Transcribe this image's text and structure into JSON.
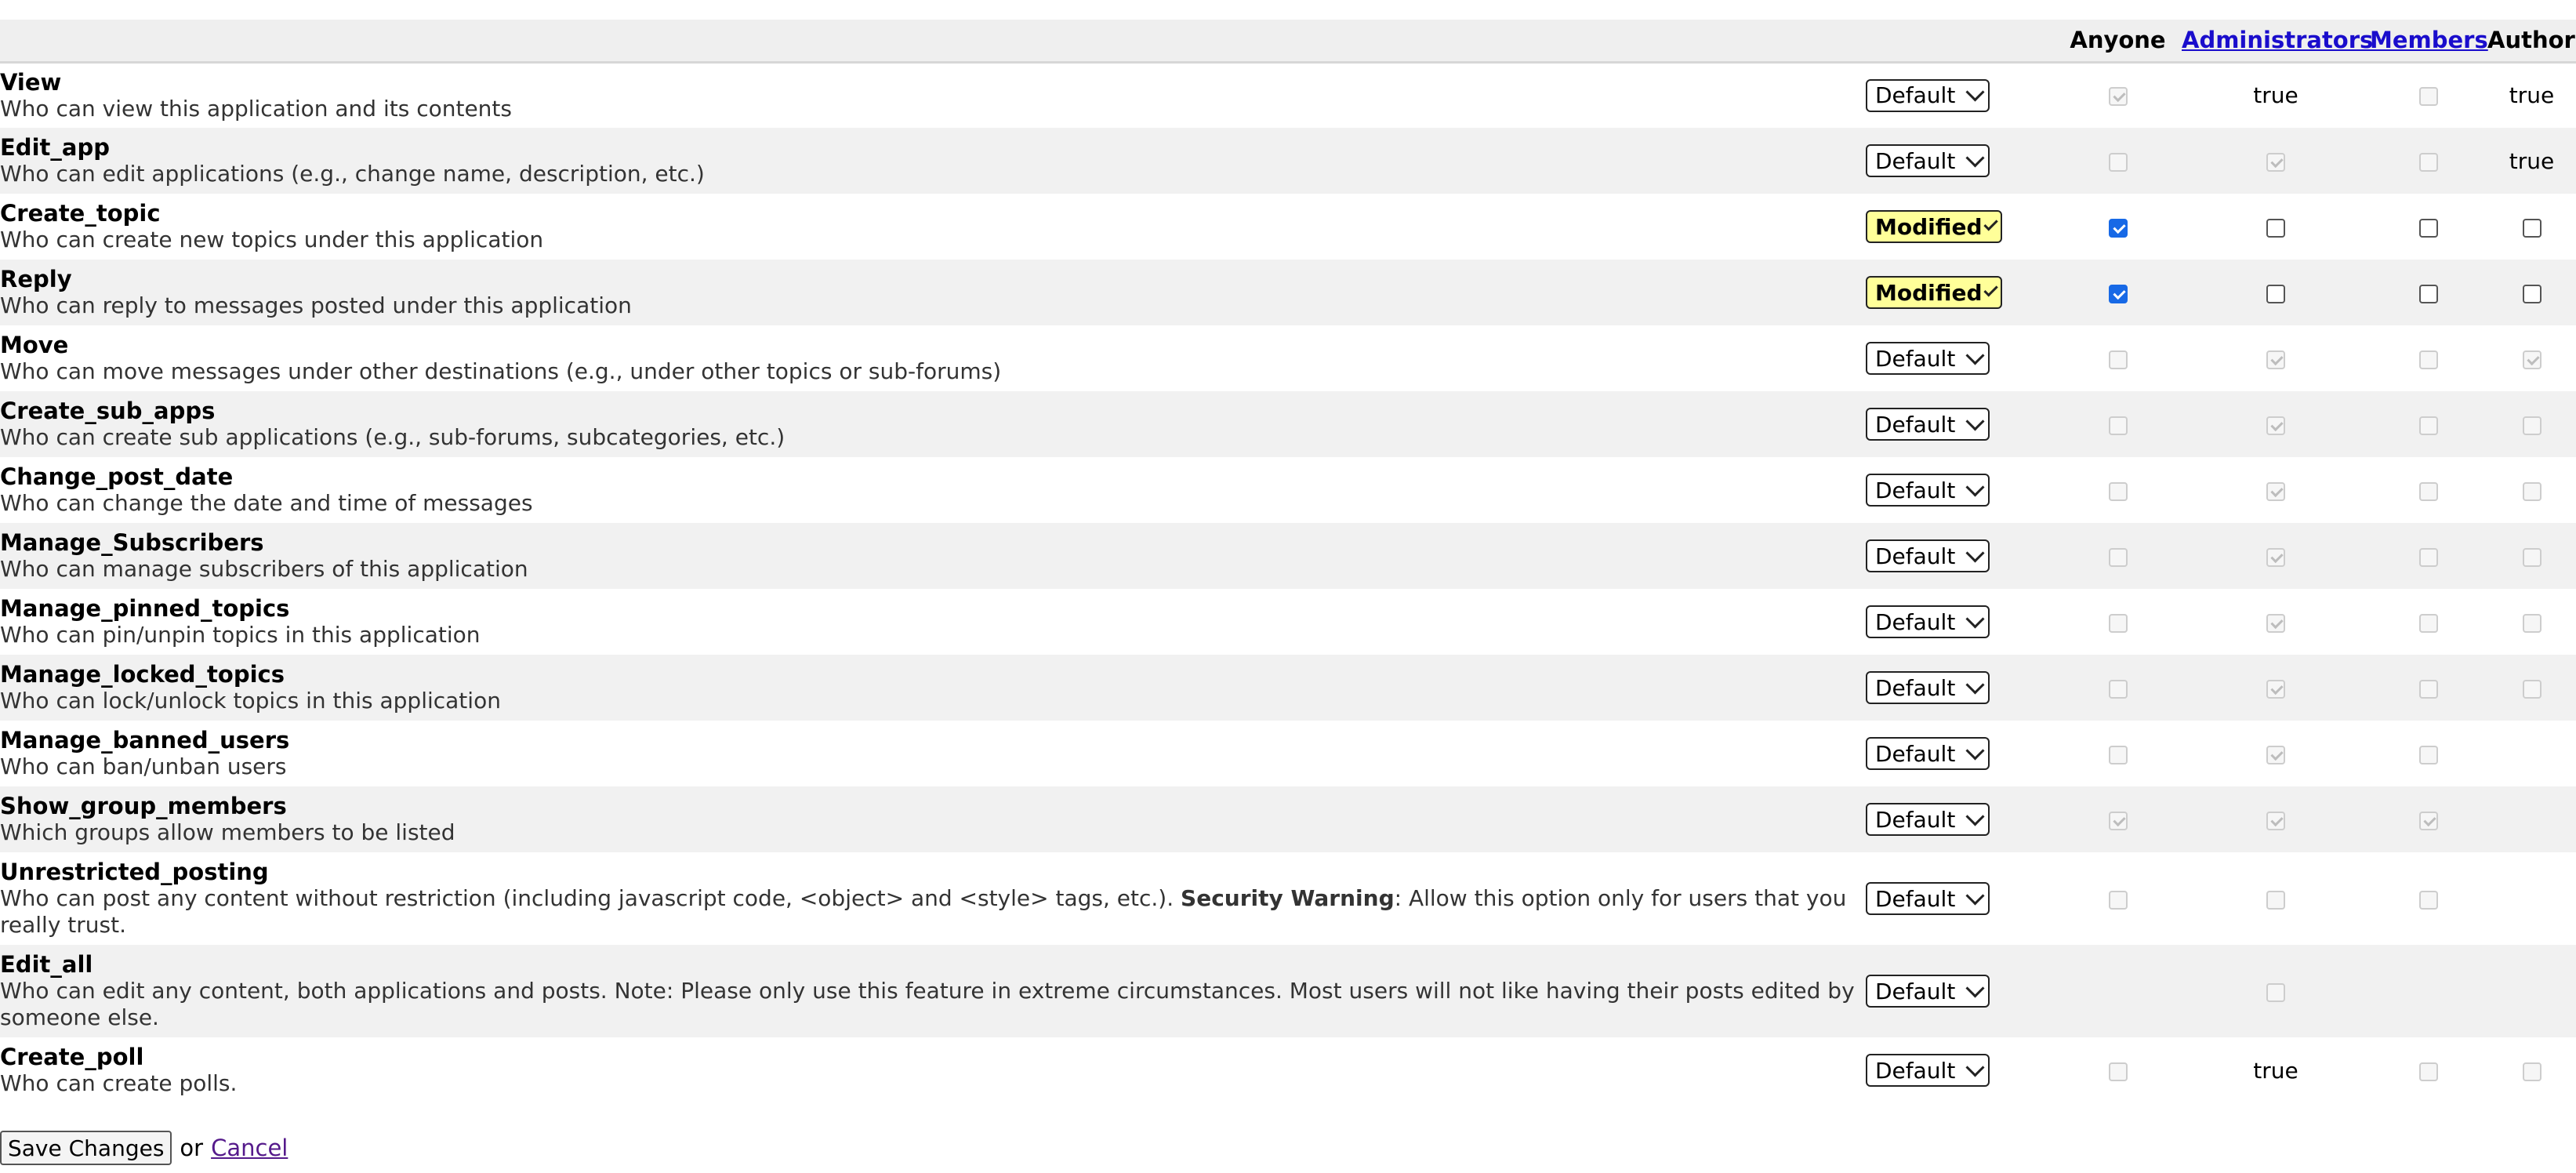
{
  "columns": {
    "anyone": "Anyone",
    "administrators": "Administrators",
    "members": "Members",
    "authors": "Authors"
  },
  "rows": [
    {
      "name": "View",
      "desc": "Who can view this application and its contents",
      "select": "Default",
      "cells": [
        "checked-disabled",
        "text:true",
        "disabled",
        "text:true"
      ]
    },
    {
      "name": "Edit_app",
      "desc": "Who can edit applications (e.g., change name, description, etc.)",
      "select": "Default",
      "cells": [
        "disabled",
        "checked-disabled",
        "disabled",
        "text:true"
      ]
    },
    {
      "name": "Create_topic",
      "desc": "Who can create new topics under this application",
      "select": "Modified",
      "cells": [
        "checked",
        "unchecked",
        "unchecked",
        "unchecked"
      ]
    },
    {
      "name": "Reply",
      "desc": "Who can reply to messages posted under this application",
      "select": "Modified",
      "cells": [
        "checked",
        "unchecked",
        "unchecked",
        "unchecked"
      ]
    },
    {
      "name": "Move",
      "desc": "Who can move messages under other destinations (e.g., under other topics or sub-forums)",
      "select": "Default",
      "cells": [
        "disabled",
        "checked-disabled",
        "disabled",
        "checked-disabled"
      ]
    },
    {
      "name": "Create_sub_apps",
      "desc": "Who can create sub applications (e.g., sub-forums, subcategories, etc.)",
      "select": "Default",
      "cells": [
        "disabled",
        "checked-disabled",
        "disabled",
        "disabled"
      ]
    },
    {
      "name": "Change_post_date",
      "desc": "Who can change the date and time of messages",
      "select": "Default",
      "cells": [
        "disabled",
        "checked-disabled",
        "disabled",
        "disabled"
      ]
    },
    {
      "name": "Manage_Subscribers",
      "desc": "Who can manage subscribers of this application",
      "select": "Default",
      "cells": [
        "disabled",
        "checked-disabled",
        "disabled",
        "disabled"
      ]
    },
    {
      "name": "Manage_pinned_topics",
      "desc": "Who can pin/unpin topics in this application",
      "select": "Default",
      "cells": [
        "disabled",
        "checked-disabled",
        "disabled",
        "disabled"
      ]
    },
    {
      "name": "Manage_locked_topics",
      "desc": "Who can lock/unlock topics in this application",
      "select": "Default",
      "cells": [
        "disabled",
        "checked-disabled",
        "disabled",
        "disabled"
      ]
    },
    {
      "name": "Manage_banned_users",
      "desc": "Who can ban/unban users",
      "select": "Default",
      "cells": [
        "disabled",
        "checked-disabled",
        "disabled",
        "none"
      ]
    },
    {
      "name": "Show_group_members",
      "desc": "Which groups allow members to be listed",
      "select": "Default",
      "cells": [
        "checked-disabled",
        "checked-disabled",
        "checked-disabled",
        "none"
      ]
    },
    {
      "name": "Unrestricted_posting",
      "desc": "Who can post any content without restriction (including javascript code, <object> and <style> tags, etc.).",
      "desc_bold": "Security Warning",
      "desc_after": ": Allow this option only for users that you really trust.",
      "select": "Default",
      "cells": [
        "disabled",
        "disabled",
        "disabled",
        "none"
      ]
    },
    {
      "name": "Edit_all",
      "desc": "Who can edit any content, both applications and posts. Note: Please only use this feature in extreme circumstances. Most users will not like having their posts edited by someone else.",
      "select": "Default",
      "cells": [
        "none",
        "disabled",
        "none",
        "none"
      ]
    },
    {
      "name": "Create_poll",
      "desc": "Who can create polls.",
      "select": "Default",
      "cells": [
        "disabled",
        "text:true",
        "disabled",
        "disabled"
      ]
    }
  ],
  "footer": {
    "save_label": "Save Changes",
    "or_text": "or",
    "cancel_label": "Cancel"
  },
  "colors": {
    "header_bg": "#efefef",
    "alt_row_bg": "#f1f1f1",
    "modified_bg": "#ffff99",
    "link": "#1a0dcc",
    "visited_link": "#551a8b",
    "checkbox_checked": "#1769e6"
  }
}
